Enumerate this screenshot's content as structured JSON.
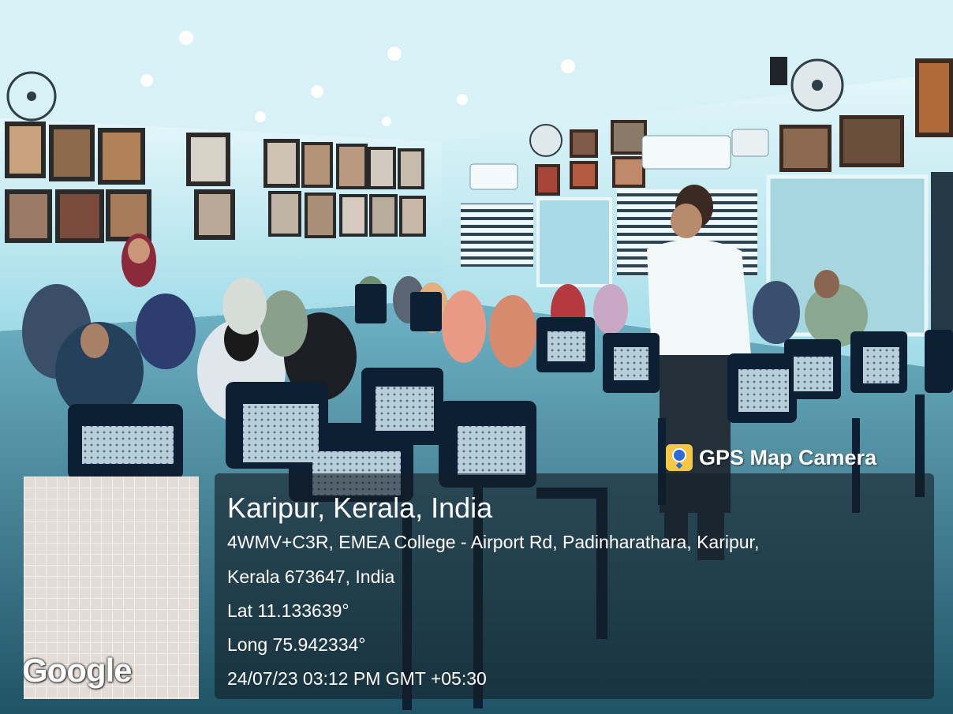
{
  "brand": {
    "text": "GPS Map Camera",
    "icon": "camera-pin-icon"
  },
  "location": {
    "title": "Karipur, Kerala, India",
    "address_line1": "4WMV+C3R, EMEA College - Airport Rd, Padinharathara, Karipur,",
    "address_line2": "Kerala 673647, India",
    "latitude": "Lat 11.133639°",
    "longitude": "Long 75.942334°",
    "datetime": "24/07/23 03:12 PM GMT +05:30"
  },
  "map": {
    "logo_text": "Google"
  },
  "colors": {
    "wall": "#cfeff6",
    "ceiling": "#d9f3f7",
    "floor": "#3b7d92",
    "chair": "#0d1f33",
    "chair_back": "#a9c2d2",
    "overlay": "#141e28"
  }
}
